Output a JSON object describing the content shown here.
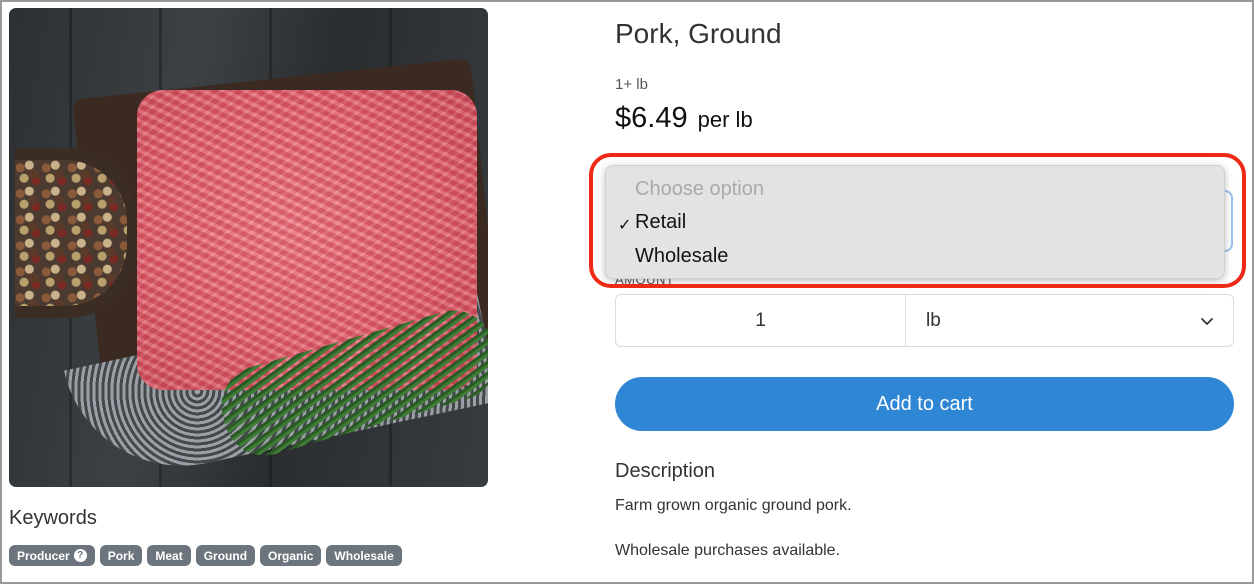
{
  "product": {
    "title": "Pork, Ground",
    "quantity_note": "1+ lb",
    "price": "$6.49",
    "price_unit": "per lb"
  },
  "dropdown": {
    "placeholder": "Choose option",
    "options": [
      "Retail",
      "Wholesale"
    ],
    "selected": "Retail",
    "check_glyph": "✓"
  },
  "amount": {
    "label": "AMOUNT",
    "value": "1",
    "unit": "lb"
  },
  "cart": {
    "button_label": "Add to cart"
  },
  "description": {
    "heading": "Description",
    "line1": "Farm grown organic ground pork.",
    "line2": "Wholesale purchases available."
  },
  "keywords": {
    "heading": "Keywords",
    "tags": [
      "Producer",
      "Pork",
      "Meat",
      "Ground",
      "Organic",
      "Wholesale"
    ],
    "help_glyph": "?"
  },
  "colors": {
    "primary_button": "#2f86d4",
    "tag_background": "#6c757d",
    "highlight": "#ee2a17"
  }
}
